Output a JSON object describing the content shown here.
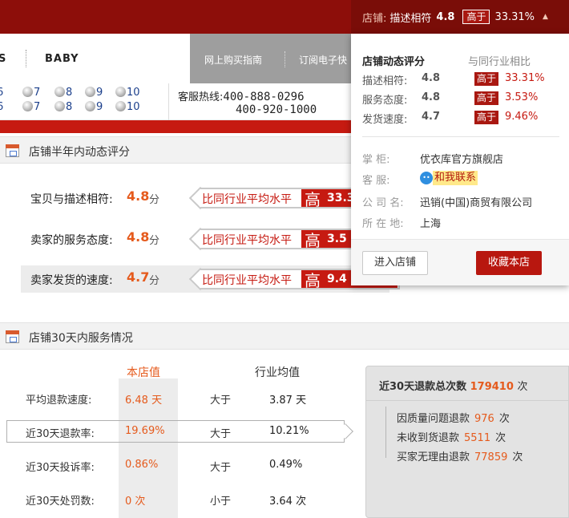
{
  "topbar": {
    "shop_label": "店铺:",
    "metric_label": "描述相符",
    "metric_score": "4.8",
    "high_label": "高于",
    "metric_pct": "33.31%"
  },
  "nav": {
    "partial_item": "S",
    "baby": "BABY",
    "guide": "网上购买指南",
    "subscribe": "订阅电子快"
  },
  "sizes": {
    "row1": [
      "6",
      "7",
      "8",
      "9",
      "10"
    ],
    "row2": [
      "6",
      "7",
      "8",
      "9",
      "10"
    ]
  },
  "hotline": {
    "label": "客服热线:",
    "number1": "400-888-0296",
    "number2": "400-920-1000"
  },
  "rating_section": {
    "title": "店铺半年内动态评分",
    "compare_text": "比同行业平均水平",
    "high_char": "高",
    "unit": "分",
    "rows": [
      {
        "label": "宝贝与描述相符:",
        "score": "4.8",
        "pct": "33.3"
      },
      {
        "label": "卖家的服务态度:",
        "score": "4.8",
        "pct": "3.5"
      },
      {
        "label": "卖家发货的速度:",
        "score": "4.7",
        "pct": "9.4"
      }
    ]
  },
  "service_section": {
    "title": "店铺30天内服务情况",
    "col_shop": "本店值",
    "col_industry": "行业均值",
    "rows": [
      {
        "label": "平均退款速度:",
        "value": "6.48 天",
        "compare": "大于",
        "avg": "3.87 天"
      },
      {
        "label": "近30天退款率:",
        "value": "19.69%",
        "compare": "大于",
        "avg": "10.21%"
      },
      {
        "label": "近30天投诉率:",
        "value": "0.86%",
        "compare": "大于",
        "avg": "0.49%"
      },
      {
        "label": "近30天处罚数:",
        "value": "0 次",
        "compare": "小于",
        "avg": "3.64 次"
      }
    ]
  },
  "refund_panel": {
    "head_label": "近30天退款总次数",
    "head_count": "179410",
    "unit": "次",
    "items": [
      {
        "label": "因质量问题退款",
        "count": "976"
      },
      {
        "label": "未收到货退款",
        "count": "5511"
      },
      {
        "label": "买家无理由退款",
        "count": "77859"
      }
    ]
  },
  "popup": {
    "head_left": "店铺动态评分",
    "head_right": "与同行业相比",
    "high_label": "高于",
    "scores": [
      {
        "label": "描述相符:",
        "score": "4.8",
        "pct": "33.31%"
      },
      {
        "label": "服务态度:",
        "score": "4.8",
        "pct": "3.53%"
      },
      {
        "label": "发货速度:",
        "score": "4.7",
        "pct": "9.46%"
      }
    ],
    "info": {
      "keeper_label": "掌    柜:",
      "keeper_value": "优衣库官方旗舰店",
      "service_label": "客    服:",
      "service_value": "和我联系",
      "company_label": "公 司 名:",
      "company_value": "迅销(中国)商贸有限公司",
      "location_label": "所 在 地:",
      "location_value": "上海"
    },
    "enter_button": "进入店铺",
    "favorite_button": "收藏本店"
  },
  "colors": {
    "brand_red": "#c61a11",
    "dark_red": "#8d0e0a",
    "accent_orange": "#e55a1c"
  }
}
